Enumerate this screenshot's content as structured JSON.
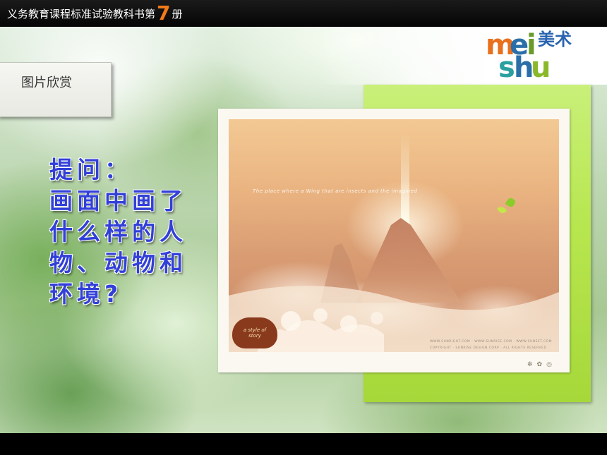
{
  "header": {
    "title_prefix": "义务教育课程标准试验教科书第",
    "volume_number": "7",
    "title_suffix": "册"
  },
  "logo": {
    "letters_top": [
      "m",
      "e",
      "i"
    ],
    "letters_bottom": [
      "s",
      "h",
      "u"
    ],
    "chinese": "美术",
    "colors": [
      "#e8701e",
      "#2b6fa8",
      "#6a9a2a",
      "#2aa0a0",
      "#2b6fa8",
      "#8ab82a"
    ]
  },
  "section": {
    "label": "图片欣赏"
  },
  "question": {
    "lines": [
      "提问：",
      "画面中画了",
      "什么样的人",
      "物、动物和",
      "环境?"
    ],
    "color": "#3240d8"
  },
  "artwork": {
    "sky_caption": "The place where a Wing that are insects and the imagined",
    "brand_mark_text": "a style of story",
    "credits": [
      "WWW.SUNRIGHT.COM · WWW.SUNRISE.COM · WWW.SUNSET.COM",
      "COPYRIGHT · SUNRISE DESIGN CORP · ALL RIGHTS RESERVED"
    ],
    "icons": [
      "swirl-icon",
      "leaf-icon",
      "circle-icon"
    ]
  },
  "panel_color": "#b7e64e"
}
